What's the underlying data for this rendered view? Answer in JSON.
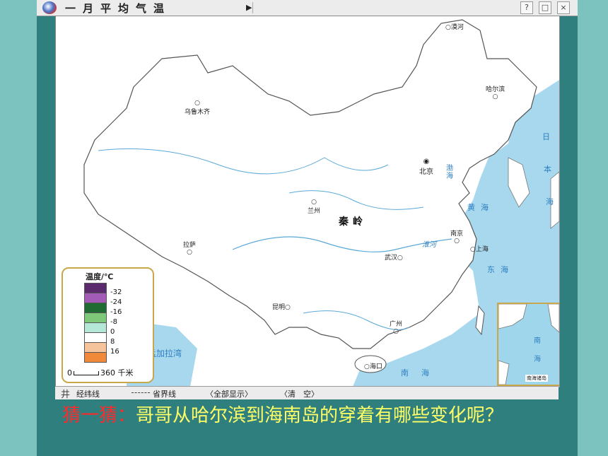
{
  "window": {
    "title": "一月平均气温",
    "help": "?",
    "restore": "□",
    "close": "×"
  },
  "map": {
    "cities": [
      {
        "name": "漠河",
        "id": "mohe"
      },
      {
        "name": "哈尔滨",
        "id": "harbin"
      },
      {
        "name": "乌鲁木齐",
        "id": "urumqi"
      },
      {
        "name": "北京",
        "id": "beijing"
      },
      {
        "name": "兰州",
        "id": "lanzhou"
      },
      {
        "name": "南京",
        "id": "nanjing"
      },
      {
        "name": "上海",
        "id": "shanghai"
      },
      {
        "name": "武汉",
        "id": "wuhan"
      },
      {
        "name": "拉萨",
        "id": "lhasa"
      },
      {
        "name": "昆明",
        "id": "kunming"
      },
      {
        "name": "广州",
        "id": "guangzhou"
      },
      {
        "name": "海口",
        "id": "haikou"
      }
    ],
    "region_label": "秦岭",
    "river_label": "淮河",
    "seas": [
      "日",
      "本",
      "海",
      "渤海",
      "黄海",
      "东海",
      "南海",
      "孟加拉湾"
    ],
    "inset_label": "南海诸岛",
    "inset_sea": "南海"
  },
  "legend": {
    "title": "温度/℃",
    "items": [
      {
        "color": "#5a2a6c",
        "value": "-32"
      },
      {
        "color": "#a35bb8",
        "value": "-24"
      },
      {
        "color": "#1f6b33",
        "value": "-16"
      },
      {
        "color": "#7ec87a",
        "value": "-8"
      },
      {
        "color": "#b5e7d8",
        "value": "0"
      },
      {
        "color": "#ffffff",
        "value": "8"
      },
      {
        "color": "#f6c49a",
        "value": "16"
      },
      {
        "color": "#f08a3a",
        "value": ""
      }
    ],
    "scale_start": "0",
    "scale_end": "360 千米"
  },
  "toolbar": {
    "grid_icon": "井",
    "graticule": "经纬线",
    "province": "省界线",
    "show_all": "〈全部显示〉",
    "clear": "〈清　空〉"
  },
  "question": {
    "prefix": "猜一猜：",
    "text": "哥哥从哈尔滨到海南岛的穿着有哪些变化呢？"
  }
}
